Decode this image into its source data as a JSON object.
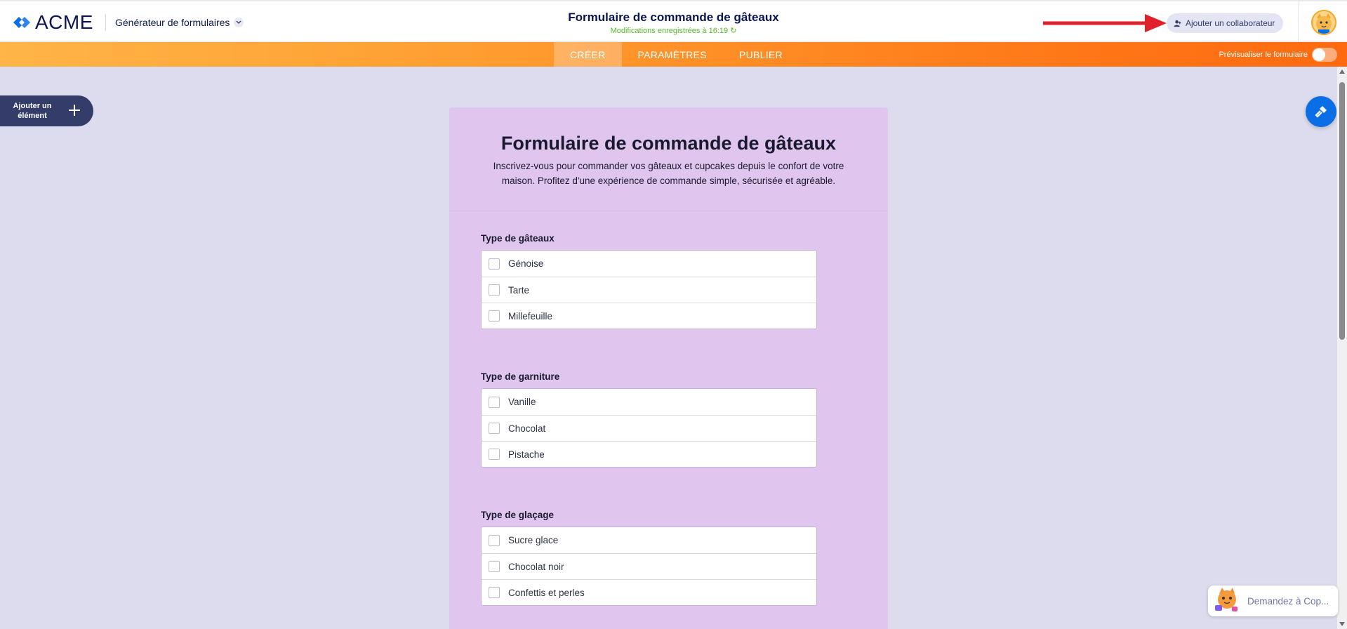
{
  "header": {
    "logo_text": "ACME",
    "app_name": "Générateur de formulaires",
    "form_title": "Formulaire de commande de gâteaux",
    "saved_status": "Modifications enregistrées à 16:19",
    "collaborator_button": "Ajouter un collaborateur"
  },
  "nav": {
    "tabs": [
      {
        "label": "CRÉER",
        "active": true
      },
      {
        "label": "PARAMÈTRES",
        "active": false
      },
      {
        "label": "PUBLIER",
        "active": false
      }
    ],
    "preview_label": "Prévisualiser le formulaire",
    "preview_enabled": false
  },
  "sidebar": {
    "add_element_label": "Ajouter un élément"
  },
  "form": {
    "heading": "Formulaire de commande de gâteaux",
    "description": "Inscrivez-vous pour commander vos gâteaux et cupcakes depuis le confort de votre maison. Profitez d'une expérience de commande simple, sécurisée et agréable.",
    "questions": [
      {
        "label": "Type de gâteaux",
        "options": [
          "Génoise",
          "Tarte",
          "Millefeuille"
        ]
      },
      {
        "label": "Type de garniture",
        "options": [
          "Vanille",
          "Chocolat",
          "Pistache"
        ]
      },
      {
        "label": "Type de glaçage",
        "options": [
          "Sucre glace",
          "Chocolat noir",
          "Confettis et perles"
        ]
      }
    ]
  },
  "copilot": {
    "label": "Demandez à Cop..."
  },
  "colors": {
    "brand_navy": "#0a1551",
    "accent_orange": "#ff7b1a",
    "form_background": "#e0c6ef",
    "designer_blue": "#0a6ee6",
    "saved_green": "#56b82c",
    "arrow_red": "#e0202a"
  }
}
